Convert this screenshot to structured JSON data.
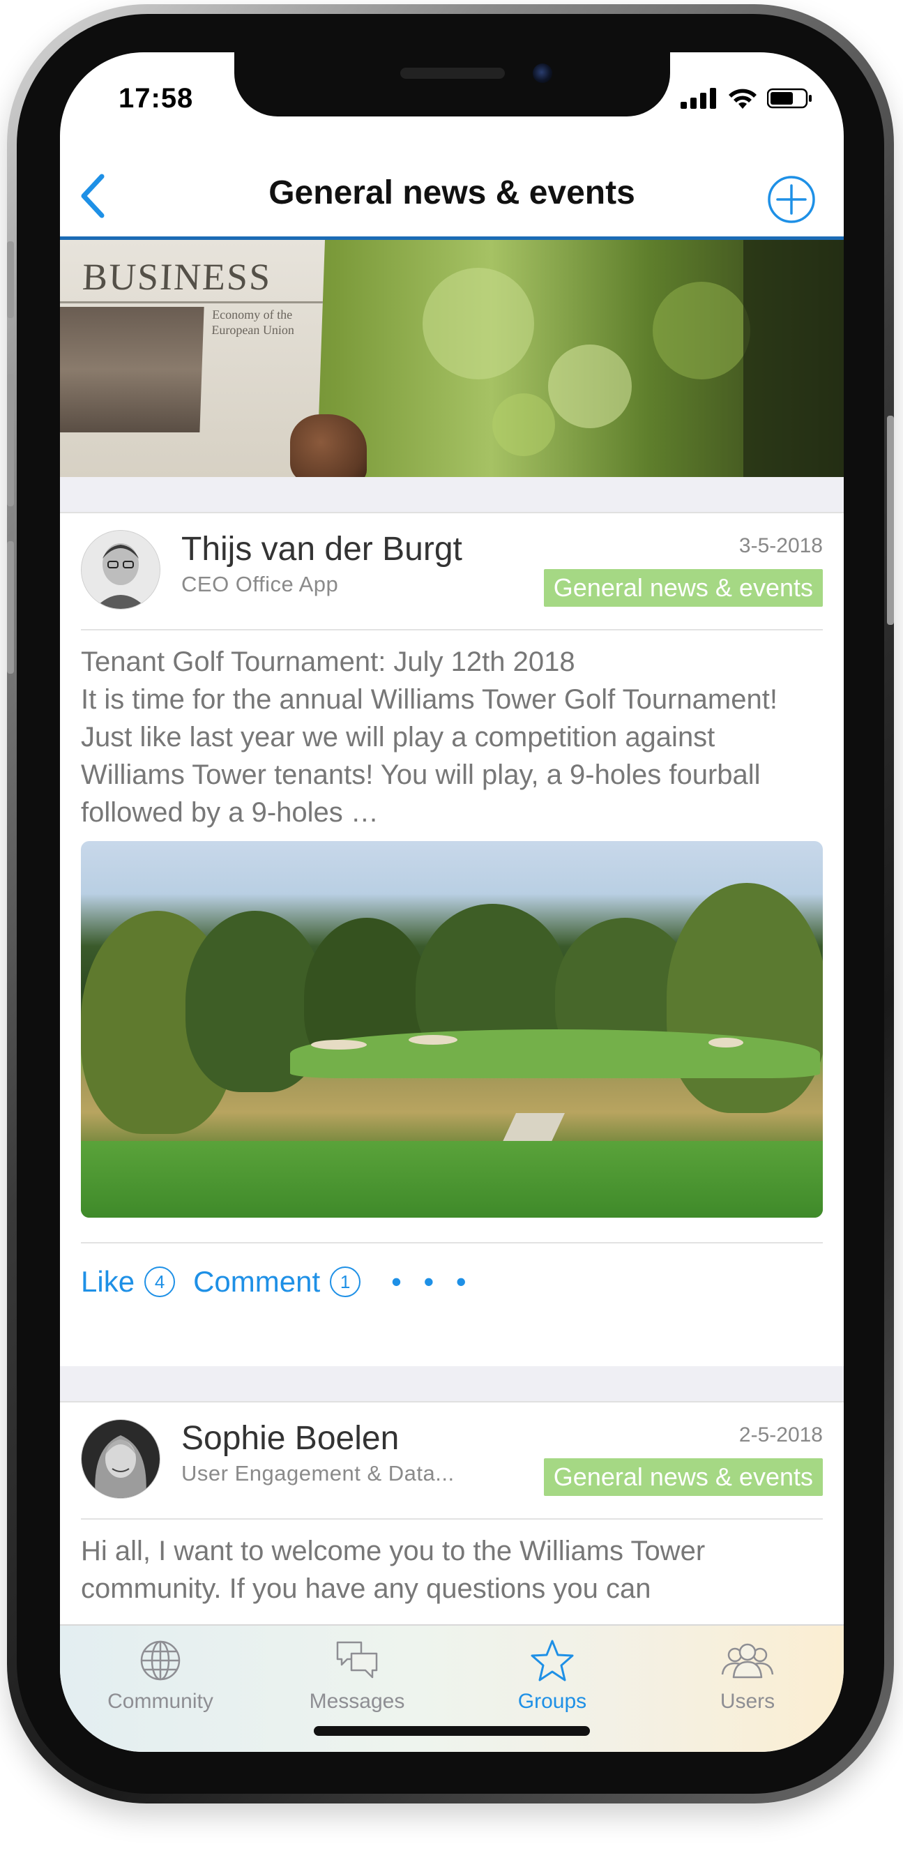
{
  "status_bar": {
    "time": "17:58"
  },
  "nav": {
    "title": "General news & events",
    "back_icon": "chevron-left-icon",
    "add_icon": "plus-circle-icon"
  },
  "banner": {
    "newspaper_headline": "BUSINESS",
    "newspaper_subline_1": "Economy of the",
    "newspaper_subline_2": "European Union"
  },
  "posts": [
    {
      "author": "Thijs van der Burgt",
      "role": "CEO Office App",
      "date": "3-5-2018",
      "group": "General news & events",
      "text": "Tenant Golf Tournament: July 12th 2018\nIt is time for the annual Williams Tower Golf Tournament! Just like last year we will play a competition against Williams Tower tenants! You will play, a 9-holes fourball followed by a 9-holes …",
      "actions": {
        "like_label": "Like",
        "like_count": "4",
        "comment_label": "Comment",
        "comment_count": "1",
        "more": "• • •"
      }
    },
    {
      "author": "Sophie Boelen",
      "role": "User Engagement & Data...",
      "date": "2-5-2018",
      "group": "General news & events",
      "text": "Hi all, I want to welcome you to the Williams Tower community. If you have any questions you can"
    }
  ],
  "tabs": [
    {
      "label": "Community",
      "icon": "globe-icon",
      "active": false
    },
    {
      "label": "Messages",
      "icon": "chat-bubbles-icon",
      "active": false
    },
    {
      "label": "Groups",
      "icon": "star-icon",
      "active": true
    },
    {
      "label": "Users",
      "icon": "users-icon",
      "active": false
    }
  ],
  "colors": {
    "accent": "#1e90e6",
    "nav_underline": "#1b6bb5",
    "tag_green": "#a5d884",
    "muted_text": "#777777"
  }
}
